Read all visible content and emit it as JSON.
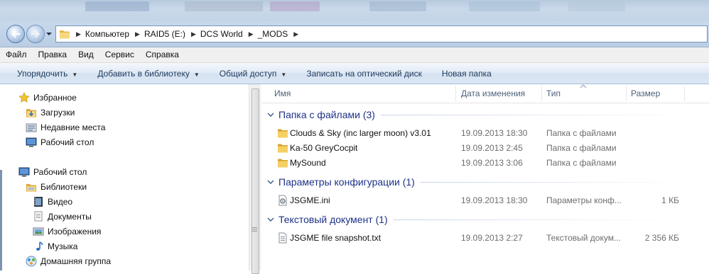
{
  "address": {
    "crumbs": [
      "Компьютер",
      "RAID5 (E:)",
      "DCS World",
      "_MODS"
    ]
  },
  "menu": [
    "Файл",
    "Правка",
    "Вид",
    "Сервис",
    "Справка"
  ],
  "commands": [
    {
      "label": "Упорядочить",
      "dropdown": true
    },
    {
      "label": "Добавить в библиотеку",
      "dropdown": true
    },
    {
      "label": "Общий доступ",
      "dropdown": true
    },
    {
      "label": "Записать на оптический диск",
      "dropdown": false
    },
    {
      "label": "Новая папка",
      "dropdown": false
    }
  ],
  "nav": {
    "favorites": {
      "label": "Избранное",
      "items": [
        "Загрузки",
        "Недавние места",
        "Рабочий стол"
      ]
    },
    "desktop": "Рабочий стол",
    "libraries": {
      "label": "Библиотеки",
      "items": [
        "Видео",
        "Документы",
        "Изображения",
        "Музыка"
      ]
    },
    "homegroup": "Домашняя группа"
  },
  "columns": {
    "name": "Имя",
    "date": "Дата изменения",
    "type": "Тип",
    "size": "Размер"
  },
  "groups": [
    {
      "title": "Папка с файлами (3)",
      "items": [
        {
          "name": "Clouds & Sky (inc larger moon) v3.01",
          "date": "19.09.2013 18:30",
          "type": "Папка с файлами",
          "size": "",
          "icon": "folder-icon"
        },
        {
          "name": "Ka-50 GreyCocpit",
          "date": "19.09.2013 2:45",
          "type": "Папка с файлами",
          "size": "",
          "icon": "folder-icon"
        },
        {
          "name": "MySound",
          "date": "19.09.2013 3:06",
          "type": "Папка с файлами",
          "size": "",
          "icon": "folder-icon"
        }
      ]
    },
    {
      "title": "Параметры конфигурации (1)",
      "items": [
        {
          "name": "JSGME.ini",
          "date": "19.09.2013 18:30",
          "type": "Параметры конф...",
          "size": "1 КБ",
          "icon": "config-file-icon"
        }
      ]
    },
    {
      "title": "Текстовый документ (1)",
      "items": [
        {
          "name": "JSGME file snapshot.txt",
          "date": "19.09.2013 2:27",
          "type": "Текстовый докум...",
          "size": "2 356 КБ",
          "icon": "text-file-icon"
        }
      ]
    }
  ],
  "colors": {
    "group_title": "#1e3287",
    "column_header": "#4c607a",
    "accent": "#3c7fb1"
  }
}
